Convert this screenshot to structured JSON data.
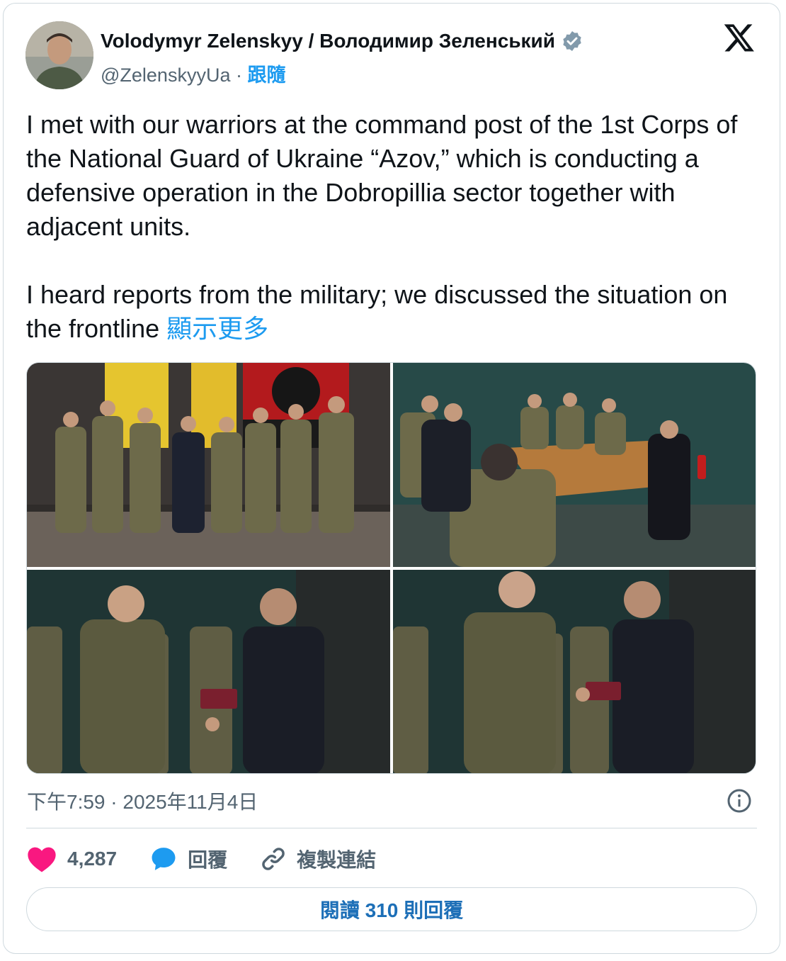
{
  "header": {
    "display_name": "Volodymyr Zelenskyy / Володимир Зеленський",
    "handle": "@ZelenskyyUa",
    "separator": "·",
    "follow_label": "跟隨",
    "verified_icon": "verified-badge-icon",
    "brand_icon": "x-logo-icon"
  },
  "tweet": {
    "text": "I met with our warriors at the command post of the 1st Corps of the National Guard of Ukraine “Azov,” which is conducting a defensive operation in the Dobropillia sector together with adjacent units.\n\nI heard reports from the military; we discussed the situation on the frontline ",
    "show_more_label": "顯示更多"
  },
  "media": {
    "count": 4
  },
  "meta": {
    "timestamp": "下午7:59 · 2025年11月4日",
    "info_icon": "info-icon"
  },
  "actions": {
    "like_count": "4,287",
    "reply_label": "回覆",
    "copy_link_label": "複製連結"
  },
  "read_replies_label": "閱讀 310 則回覆",
  "colors": {
    "link_blue": "#1d9bf0",
    "like_pink": "#f91880",
    "text_primary": "#0f1419",
    "text_secondary": "#536471",
    "border": "#cfd9de"
  }
}
